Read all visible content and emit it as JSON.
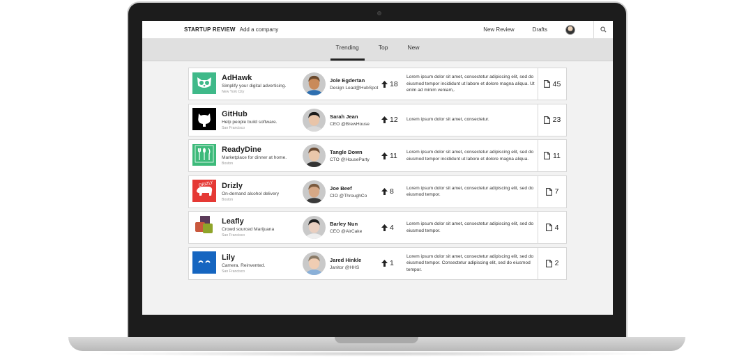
{
  "header": {
    "brand": "STARTUP REVIEW",
    "add_company": "Add a company",
    "new_review": "New Review",
    "drafts": "Drafts"
  },
  "tabs": [
    {
      "label": "Trending",
      "active": true
    },
    {
      "label": "Top",
      "active": false
    },
    {
      "label": "New",
      "active": false
    }
  ],
  "companies": [
    {
      "name": "AdHawk",
      "tagline": "Simplify your digital advertising.",
      "location": "New York City",
      "logo_icon": "owl-icon",
      "logo_color": "#3fb989",
      "reviewer": "Jole Egdertan",
      "reviewer_title": "Design Lead@HubSpot",
      "votes": "18",
      "description": "Lorem ipsum dolor sit amet, consectetur adipiscing elit, sed do eiusmod tempor incididunt ut labore et dolore magna aliqua. Ut enim ad minim veniam,.",
      "reviews": "45"
    },
    {
      "name": "GitHub",
      "tagline": "Help people build software.",
      "location": "San Francisco",
      "logo_icon": "octocat-icon",
      "logo_color": "#000000",
      "reviewer": "Sarah Jean",
      "reviewer_title": "CEO @BrewHouse",
      "votes": "12",
      "description": "Lorem ipsum dolor sit amet, consectetur.",
      "reviews": "23"
    },
    {
      "name": "ReadyDine",
      "tagline": "Marketplace for dinner at home.",
      "location": "Boston",
      "logo_icon": "cutlery-icon",
      "logo_color": "#3dba7a",
      "reviewer": "Tangle Down",
      "reviewer_title": "CTO @HouseParty",
      "votes": "11",
      "description": "Lorem ipsum dolor sit amet, consectetur adipiscing elit, sed do eiusmod tempor incididunt ut labore et dolore magna aliqua.",
      "reviews": "11"
    },
    {
      "name": "Drizly",
      "tagline": "On-demand alcohol delivery",
      "location": "Boston",
      "logo_icon": "drizly-bear-icon",
      "logo_color": "#e53935",
      "reviewer": "Joe Beef",
      "reviewer_title": "CIO @ThroughCo",
      "votes": "8",
      "description": "Lorem ipsum dolor sit amet, consectetur adipiscing elit, sed do eiusmod tempor.",
      "reviews": "7"
    },
    {
      "name": "Leafly",
      "tagline": "Crowd sourced Marijuana",
      "location": "San Francisco",
      "logo_icon": "leafly-squares-icon",
      "logo_color": "#8a9a2a",
      "reviewer": "Barley Nun",
      "reviewer_title": "CEO @AirCake",
      "votes": "4",
      "description": "Lorem ipsum dolor sit amet, consectetur adipiscing elit, sed do eiusmod tempor.",
      "reviews": "4"
    },
    {
      "name": "Lily",
      "tagline": "Camera. Reinvented.",
      "location": "San Francisco",
      "logo_icon": "lily-face-icon",
      "logo_color": "#1565c0",
      "reviewer": "Jared Hinkle",
      "reviewer_title": "Janitor @HHS",
      "votes": "1",
      "description": "Lorem ipsum dolor sit amet, consectetur adipiscing elit, sed do eiusmod tempor. Consectetur adipiscing elit, sed do eiusmod tempor.",
      "reviews": "2"
    }
  ]
}
